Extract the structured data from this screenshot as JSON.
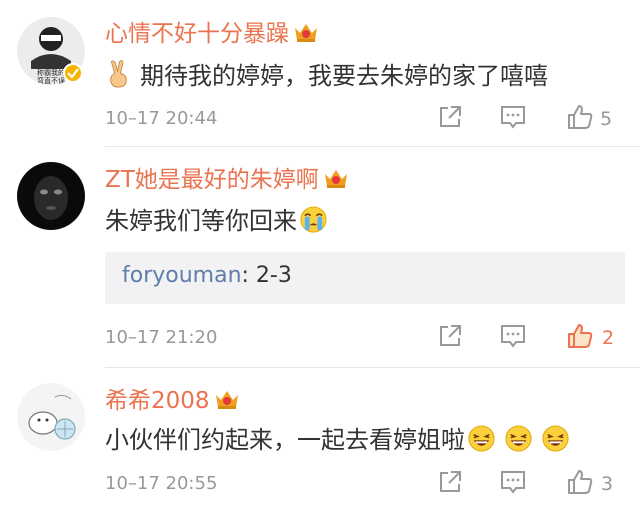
{
  "comments": [
    {
      "username": "心情不好十分暴躁",
      "text": "期待我的婷婷，我要去朱婷的家了嘻嘻",
      "time": "10–17 20:44",
      "likes": "5",
      "liked": false,
      "icons": [
        "share-icon",
        "comment-icon",
        "like-icon"
      ],
      "badge": "crown-badge-icon",
      "avatar_caption": [
        "称霸我的",
        "弯直不误"
      ]
    },
    {
      "username": "ZT她是最好的朱婷啊",
      "text": "朱婷我们等你回来",
      "reply": {
        "user": "foryouman",
        "body": ": 2-3"
      },
      "time": "10–17 21:20",
      "likes": "2",
      "liked": true,
      "badge": "crown-badge-icon"
    },
    {
      "username": "希希2008",
      "text": "小伙伴们约起来，一起去看婷姐啦",
      "time": "10–17 20:55",
      "likes": "3",
      "liked": false,
      "badge": "crown-badge-icon"
    }
  ],
  "colors": {
    "username": "#eb7350",
    "reply_user": "#5f7ea8",
    "meta": "#999999",
    "liked": "#eb7350"
  }
}
